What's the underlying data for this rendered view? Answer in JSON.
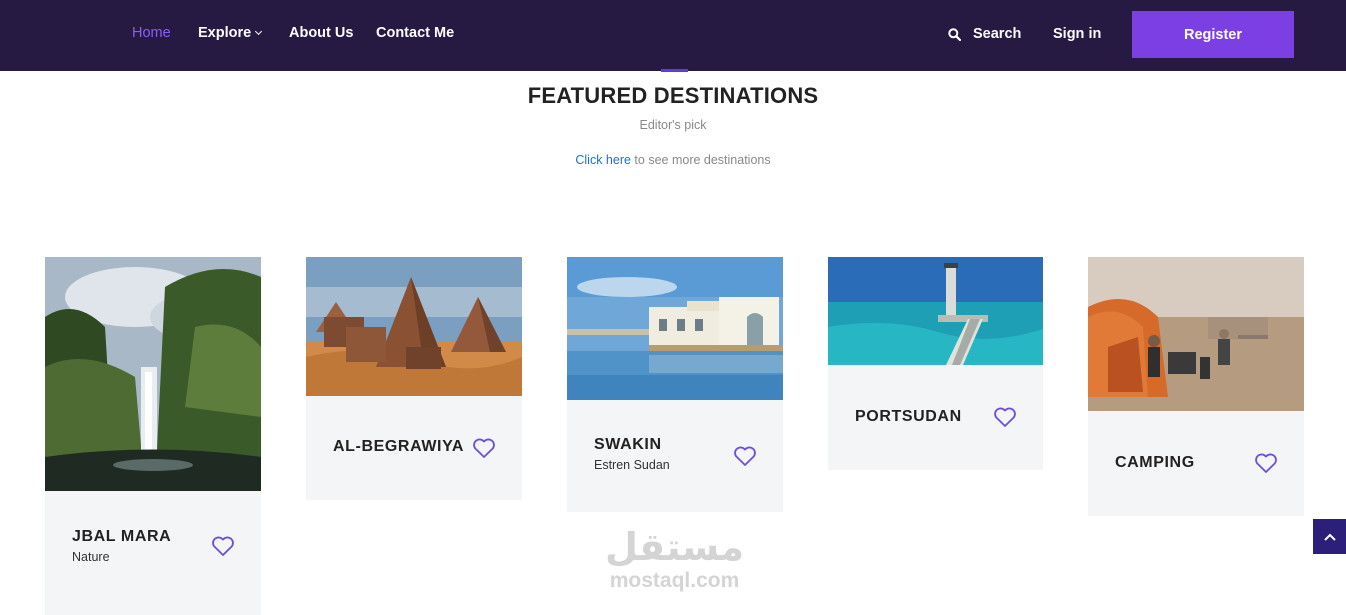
{
  "nav": {
    "home": "Home",
    "explore": "Explore",
    "about": "About Us",
    "contact": "Contact Me",
    "search": "Search",
    "signin": "Sign in",
    "register": "Register"
  },
  "section": {
    "title": "FEATURED DESTINATIONS",
    "subtitle": "Editor's pick",
    "link_text": "Click here",
    "link_rest": " to see more destinations"
  },
  "cards": [
    {
      "name": "JBAL MARA",
      "sub": "Nature"
    },
    {
      "name": "AL-BEGRAWIYA",
      "sub": ""
    },
    {
      "name": "SWAKIN",
      "sub": "Estren Sudan"
    },
    {
      "name": "PORTSUDAN",
      "sub": ""
    },
    {
      "name": "CAMPING",
      "sub": ""
    }
  ],
  "watermark": {
    "arabic": "مستقل",
    "latin": "mostaql.com"
  },
  "colors": {
    "nav_bg": "#261a42",
    "accent": "#7b3fe4",
    "heart": "#6d4de0",
    "link": "#1a6fd6"
  }
}
